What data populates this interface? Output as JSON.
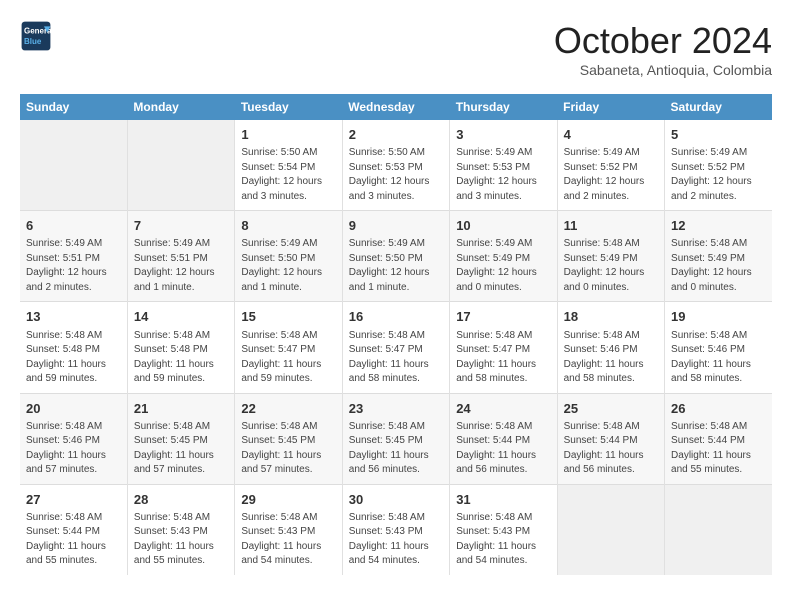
{
  "logo": {
    "line1": "General",
    "line2": "Blue"
  },
  "title": "October 2024",
  "location": "Sabaneta, Antioquia, Colombia",
  "weekdays": [
    "Sunday",
    "Monday",
    "Tuesday",
    "Wednesday",
    "Thursday",
    "Friday",
    "Saturday"
  ],
  "weeks": [
    [
      {
        "day": "",
        "info": ""
      },
      {
        "day": "",
        "info": ""
      },
      {
        "day": "1",
        "info": "Sunrise: 5:50 AM\nSunset: 5:54 PM\nDaylight: 12 hours and 3 minutes."
      },
      {
        "day": "2",
        "info": "Sunrise: 5:50 AM\nSunset: 5:53 PM\nDaylight: 12 hours and 3 minutes."
      },
      {
        "day": "3",
        "info": "Sunrise: 5:49 AM\nSunset: 5:53 PM\nDaylight: 12 hours and 3 minutes."
      },
      {
        "day": "4",
        "info": "Sunrise: 5:49 AM\nSunset: 5:52 PM\nDaylight: 12 hours and 2 minutes."
      },
      {
        "day": "5",
        "info": "Sunrise: 5:49 AM\nSunset: 5:52 PM\nDaylight: 12 hours and 2 minutes."
      }
    ],
    [
      {
        "day": "6",
        "info": "Sunrise: 5:49 AM\nSunset: 5:51 PM\nDaylight: 12 hours and 2 minutes."
      },
      {
        "day": "7",
        "info": "Sunrise: 5:49 AM\nSunset: 5:51 PM\nDaylight: 12 hours and 1 minute."
      },
      {
        "day": "8",
        "info": "Sunrise: 5:49 AM\nSunset: 5:50 PM\nDaylight: 12 hours and 1 minute."
      },
      {
        "day": "9",
        "info": "Sunrise: 5:49 AM\nSunset: 5:50 PM\nDaylight: 12 hours and 1 minute."
      },
      {
        "day": "10",
        "info": "Sunrise: 5:49 AM\nSunset: 5:49 PM\nDaylight: 12 hours and 0 minutes."
      },
      {
        "day": "11",
        "info": "Sunrise: 5:48 AM\nSunset: 5:49 PM\nDaylight: 12 hours and 0 minutes."
      },
      {
        "day": "12",
        "info": "Sunrise: 5:48 AM\nSunset: 5:49 PM\nDaylight: 12 hours and 0 minutes."
      }
    ],
    [
      {
        "day": "13",
        "info": "Sunrise: 5:48 AM\nSunset: 5:48 PM\nDaylight: 11 hours and 59 minutes."
      },
      {
        "day": "14",
        "info": "Sunrise: 5:48 AM\nSunset: 5:48 PM\nDaylight: 11 hours and 59 minutes."
      },
      {
        "day": "15",
        "info": "Sunrise: 5:48 AM\nSunset: 5:47 PM\nDaylight: 11 hours and 59 minutes."
      },
      {
        "day": "16",
        "info": "Sunrise: 5:48 AM\nSunset: 5:47 PM\nDaylight: 11 hours and 58 minutes."
      },
      {
        "day": "17",
        "info": "Sunrise: 5:48 AM\nSunset: 5:47 PM\nDaylight: 11 hours and 58 minutes."
      },
      {
        "day": "18",
        "info": "Sunrise: 5:48 AM\nSunset: 5:46 PM\nDaylight: 11 hours and 58 minutes."
      },
      {
        "day": "19",
        "info": "Sunrise: 5:48 AM\nSunset: 5:46 PM\nDaylight: 11 hours and 58 minutes."
      }
    ],
    [
      {
        "day": "20",
        "info": "Sunrise: 5:48 AM\nSunset: 5:46 PM\nDaylight: 11 hours and 57 minutes."
      },
      {
        "day": "21",
        "info": "Sunrise: 5:48 AM\nSunset: 5:45 PM\nDaylight: 11 hours and 57 minutes."
      },
      {
        "day": "22",
        "info": "Sunrise: 5:48 AM\nSunset: 5:45 PM\nDaylight: 11 hours and 57 minutes."
      },
      {
        "day": "23",
        "info": "Sunrise: 5:48 AM\nSunset: 5:45 PM\nDaylight: 11 hours and 56 minutes."
      },
      {
        "day": "24",
        "info": "Sunrise: 5:48 AM\nSunset: 5:44 PM\nDaylight: 11 hours and 56 minutes."
      },
      {
        "day": "25",
        "info": "Sunrise: 5:48 AM\nSunset: 5:44 PM\nDaylight: 11 hours and 56 minutes."
      },
      {
        "day": "26",
        "info": "Sunrise: 5:48 AM\nSunset: 5:44 PM\nDaylight: 11 hours and 55 minutes."
      }
    ],
    [
      {
        "day": "27",
        "info": "Sunrise: 5:48 AM\nSunset: 5:44 PM\nDaylight: 11 hours and 55 minutes."
      },
      {
        "day": "28",
        "info": "Sunrise: 5:48 AM\nSunset: 5:43 PM\nDaylight: 11 hours and 55 minutes."
      },
      {
        "day": "29",
        "info": "Sunrise: 5:48 AM\nSunset: 5:43 PM\nDaylight: 11 hours and 54 minutes."
      },
      {
        "day": "30",
        "info": "Sunrise: 5:48 AM\nSunset: 5:43 PM\nDaylight: 11 hours and 54 minutes."
      },
      {
        "day": "31",
        "info": "Sunrise: 5:48 AM\nSunset: 5:43 PM\nDaylight: 11 hours and 54 minutes."
      },
      {
        "day": "",
        "info": ""
      },
      {
        "day": "",
        "info": ""
      }
    ]
  ]
}
